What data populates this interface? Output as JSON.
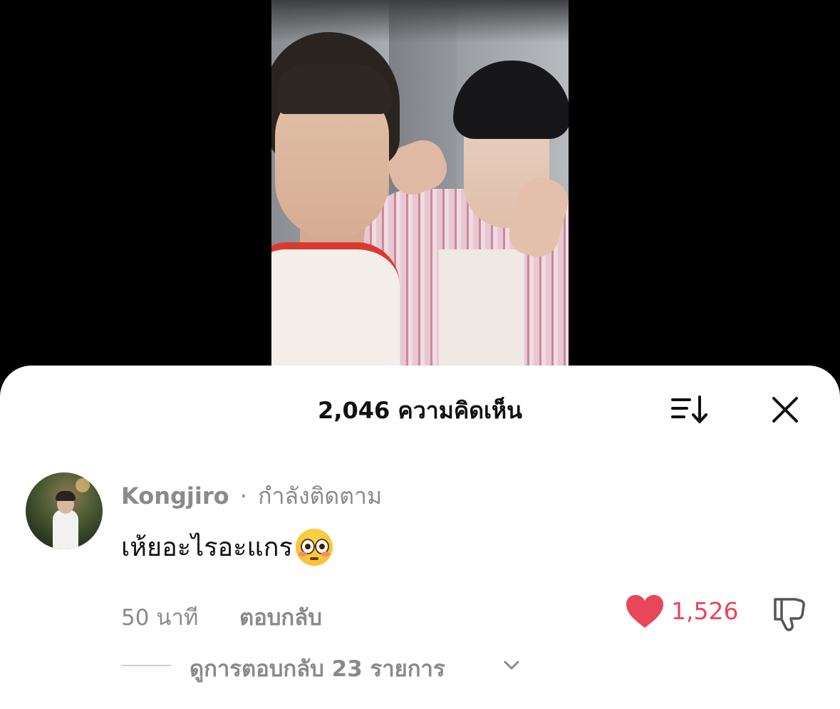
{
  "video": {
    "description_icon": "video-thumbnail"
  },
  "sheet": {
    "comment_count": "2,046 ความคิดเห็น",
    "sort_icon": "sort-icon",
    "close_icon": "close-icon"
  },
  "comment": {
    "username": "Kongjiro",
    "separator": "·",
    "follow_status": "กำลังติดตาม",
    "text": "เห้ยอะไรอะแกร",
    "emoji": "flushed-face-emoji",
    "time": "50 นาที",
    "reply_label": "ตอบกลับ",
    "like_count": "1,526",
    "like_color": "#e8465a",
    "view_replies_label": "ดูการตอบกลับ 23 รายการ"
  }
}
